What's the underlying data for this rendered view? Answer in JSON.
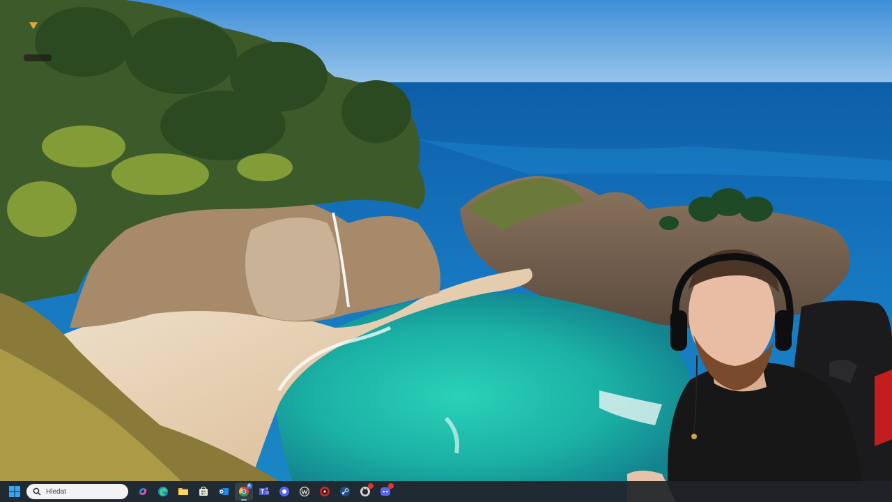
{
  "taskbar": {
    "search": {
      "placeholder": "Hledat"
    },
    "apps": [
      {
        "name": "copilot-icon",
        "active": false
      },
      {
        "name": "edge-icon",
        "active": false
      },
      {
        "name": "file-explorer-icon",
        "active": false
      },
      {
        "name": "microsoft-store-icon",
        "active": false
      },
      {
        "name": "outlook-icon",
        "active": false
      },
      {
        "name": "chrome-icon",
        "active": true,
        "badge": "A"
      },
      {
        "name": "teams-icon",
        "active": false
      },
      {
        "name": "app-circle-icon",
        "active": false
      },
      {
        "name": "wordpress-icon",
        "active": false
      },
      {
        "name": "obs-icon",
        "active": false,
        "badge": ""
      },
      {
        "name": "steam-icon",
        "active": false
      },
      {
        "name": "github-icon",
        "active": false,
        "badge": ""
      },
      {
        "name": "discord-icon",
        "active": false,
        "badge": ""
      }
    ]
  },
  "colors": {
    "taskbar_bg": "#202428",
    "accent": "#7bb8f0",
    "sky_top": "#3f8fd6",
    "sea": "#1466a8",
    "lagoon": "#22b5a3"
  }
}
